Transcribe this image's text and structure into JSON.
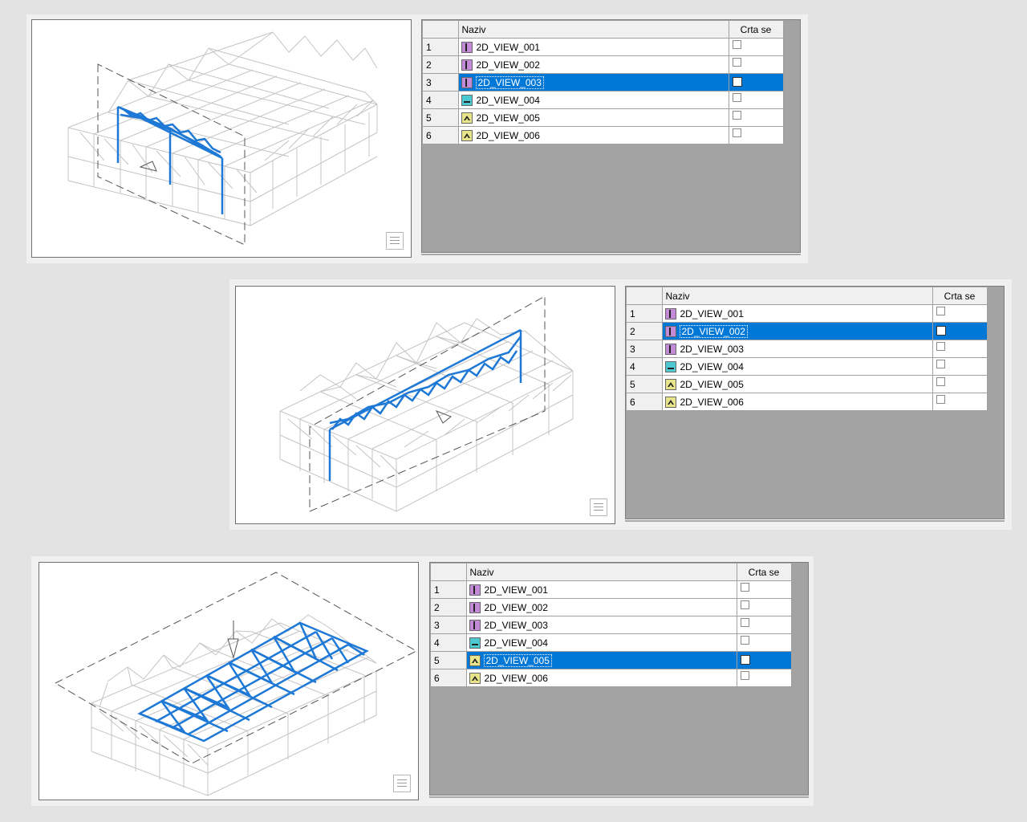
{
  "colors": {
    "selection": "#0078d7",
    "highlight_structure": "#1e78d6",
    "structure": "#c4c4c4"
  },
  "menu_icon": "list-menu-icon",
  "panels": [
    {
      "columns": {
        "index": "",
        "name": "Naziv",
        "draw": "Crta se"
      },
      "selected_index": 2,
      "rows": [
        {
          "num": "1",
          "name": "2D_VIEW_001",
          "icon": "purple",
          "checked": false
        },
        {
          "num": "2",
          "name": "2D_VIEW_002",
          "icon": "purple",
          "checked": false
        },
        {
          "num": "3",
          "name": "2D_VIEW_003",
          "icon": "purple",
          "checked": false
        },
        {
          "num": "4",
          "name": "2D_VIEW_004",
          "icon": "cyan",
          "checked": false
        },
        {
          "num": "5",
          "name": "2D_VIEW_005",
          "icon": "yellow",
          "checked": false
        },
        {
          "num": "6",
          "name": "2D_VIEW_006",
          "icon": "yellow",
          "checked": false
        }
      ]
    },
    {
      "columns": {
        "index": "",
        "name": "Naziv",
        "draw": "Crta se"
      },
      "selected_index": 1,
      "rows": [
        {
          "num": "1",
          "name": "2D_VIEW_001",
          "icon": "purple",
          "checked": false
        },
        {
          "num": "2",
          "name": "2D_VIEW_002",
          "icon": "purple",
          "checked": false
        },
        {
          "num": "3",
          "name": "2D_VIEW_003",
          "icon": "purple",
          "checked": false
        },
        {
          "num": "4",
          "name": "2D_VIEW_004",
          "icon": "cyan",
          "checked": false
        },
        {
          "num": "5",
          "name": "2D_VIEW_005",
          "icon": "yellow",
          "checked": false
        },
        {
          "num": "6",
          "name": "2D_VIEW_006",
          "icon": "yellow",
          "checked": false
        }
      ]
    },
    {
      "columns": {
        "index": "",
        "name": "Naziv",
        "draw": "Crta se"
      },
      "selected_index": 4,
      "rows": [
        {
          "num": "1",
          "name": "2D_VIEW_001",
          "icon": "purple",
          "checked": false
        },
        {
          "num": "2",
          "name": "2D_VIEW_002",
          "icon": "purple",
          "checked": false
        },
        {
          "num": "3",
          "name": "2D_VIEW_003",
          "icon": "purple",
          "checked": false
        },
        {
          "num": "4",
          "name": "2D_VIEW_004",
          "icon": "cyan",
          "checked": false
        },
        {
          "num": "5",
          "name": "2D_VIEW_005",
          "icon": "yellow",
          "checked": false
        },
        {
          "num": "6",
          "name": "2D_VIEW_006",
          "icon": "yellow",
          "checked": false
        }
      ]
    }
  ]
}
